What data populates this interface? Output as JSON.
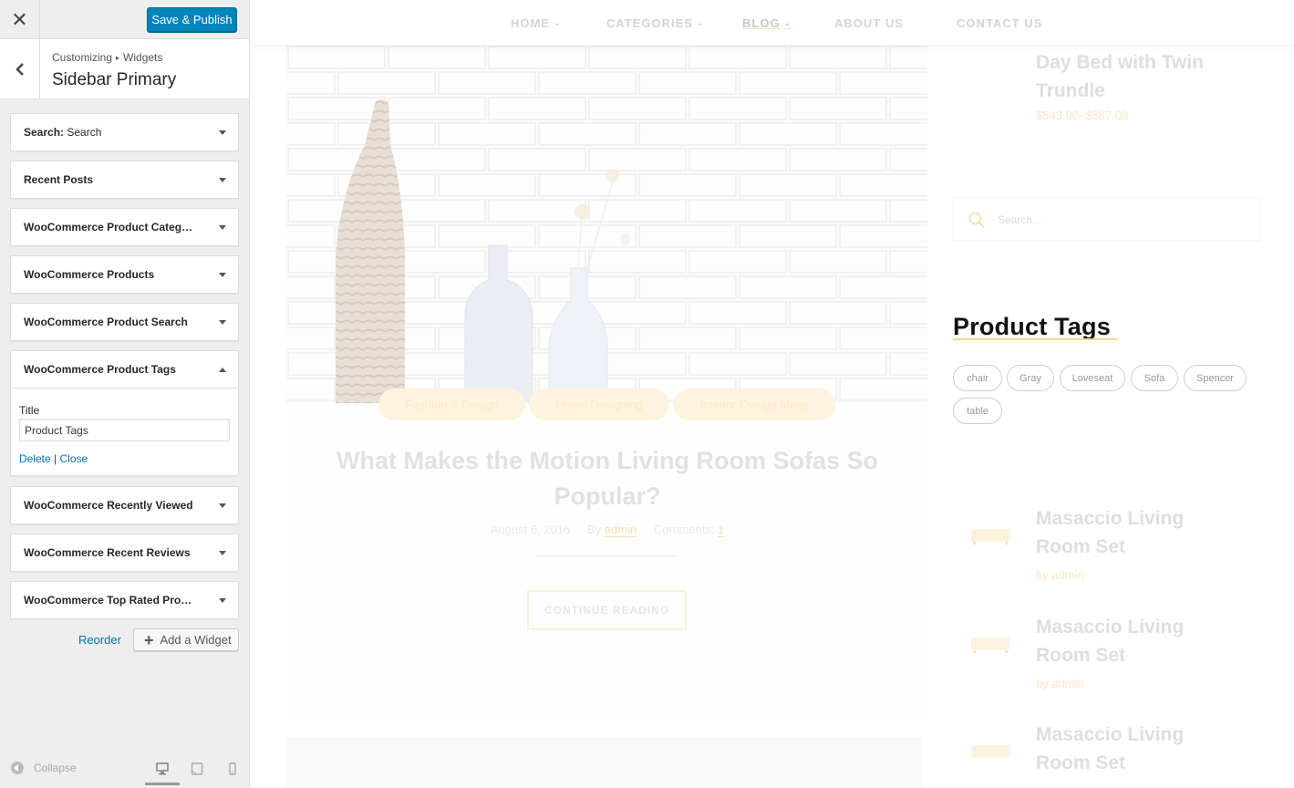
{
  "customizer": {
    "save_label": "Save & Publish",
    "close_icon": "close-icon",
    "breadcrumb_root": "Customizing",
    "breadcrumb_sep": "▸",
    "breadcrumb_panel": "Widgets",
    "section_title": "Sidebar Primary",
    "widgets": [
      {
        "label": "Search:",
        "instance": "Search",
        "expanded": false
      },
      {
        "label": "Recent Posts",
        "expanded": false
      },
      {
        "label": "WooCommerce Product Categories",
        "expanded": false
      },
      {
        "label": "WooCommerce Products",
        "expanded": false
      },
      {
        "label": "WooCommerce Product Search",
        "expanded": false
      },
      {
        "label": "WooCommerce Product Tags",
        "expanded": true
      },
      {
        "label": "WooCommerce Recently Viewed",
        "expanded": false
      },
      {
        "label": "WooCommerce Recent Reviews",
        "expanded": false
      },
      {
        "label": "WooCommerce Top Rated Products",
        "expanded": false
      }
    ],
    "expanded_form": {
      "title_label": "Title",
      "title_value": "Product Tags",
      "delete_label": "Delete",
      "separator": "|",
      "close_label": "Close"
    },
    "reorder_label": "Reorder",
    "add_widget_label": "Add a Widget",
    "collapse_label": "Collapse"
  },
  "preview": {
    "nav": [
      {
        "label": "HOME",
        "has_dropdown": true
      },
      {
        "label": "CATEGORIES",
        "has_dropdown": true
      },
      {
        "label": "BLOG",
        "has_dropdown": true,
        "active": true
      },
      {
        "label": "ABOUT US",
        "has_dropdown": false
      },
      {
        "label": "CONTACT US",
        "has_dropdown": false
      }
    ],
    "post": {
      "categories": [
        "Fashion & Design",
        "Home Designing",
        "Interior Design Ideas"
      ],
      "title": "What Makes the Motion Living Room Sofas So Popular?",
      "date": "August 6, 2016",
      "by_label": "By",
      "author": "admin",
      "comments_label": "Comments:",
      "comments_count": "1",
      "continue_label": "CONTINUE READING"
    },
    "sidebar": {
      "top_product": {
        "title": "Day Bed with Twin Trundle",
        "price": "$543.00–$567.00"
      },
      "search_placeholder": "Search...",
      "product_tags_heading": "Product Tags",
      "tags": [
        "chair",
        "Gray",
        "Loveseat",
        "Sofa",
        "Spencer",
        "table"
      ],
      "recent": [
        {
          "title": "Masaccio Living Room Set",
          "byline": "by admin"
        },
        {
          "title": "Masaccio Living Room Set",
          "byline": "by admin"
        },
        {
          "title": "Masaccio Living Room Set",
          "byline": ""
        }
      ]
    }
  },
  "colors": {
    "primary_button": "#0085ba",
    "link": "#0073aa",
    "accent": "#f5d98a"
  }
}
